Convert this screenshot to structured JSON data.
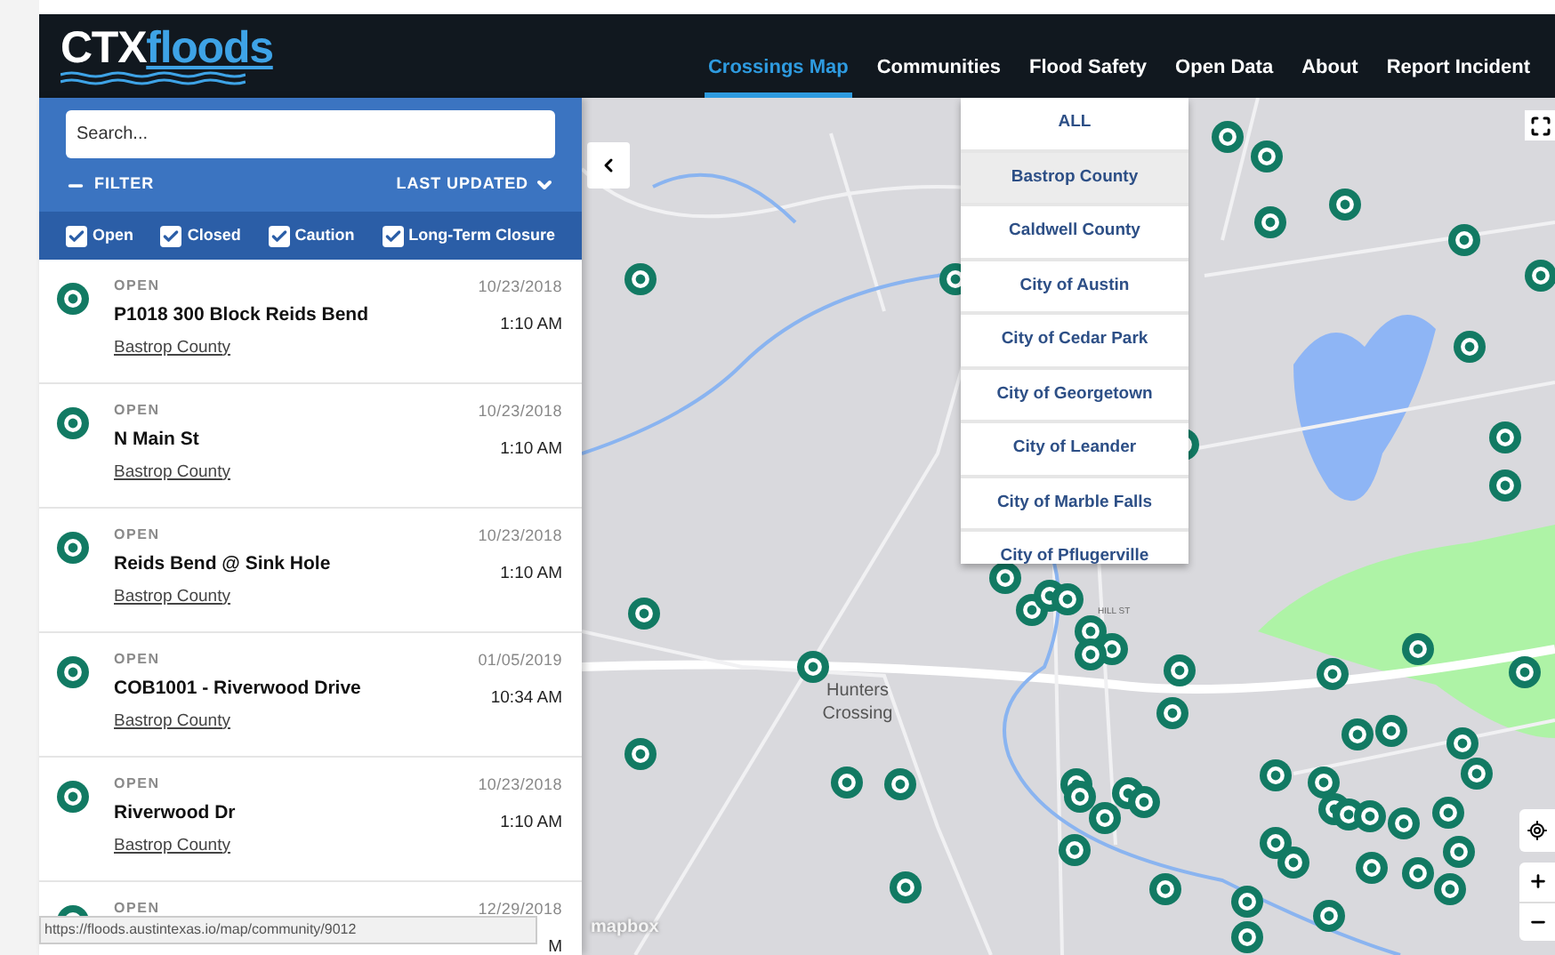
{
  "logo": {
    "prefix": "CTX",
    "suffix": "floods"
  },
  "nav": [
    {
      "label": "Crossings Map",
      "selected": true
    },
    {
      "label": "Communities",
      "selected": false
    },
    {
      "label": "Flood Safety",
      "selected": false
    },
    {
      "label": "Open Data",
      "selected": false
    },
    {
      "label": "About",
      "selected": false
    },
    {
      "label": "Report Incident",
      "selected": false
    }
  ],
  "communities_menu": [
    {
      "label": "ALL",
      "selected": false
    },
    {
      "label": "Bastrop County",
      "selected": true
    },
    {
      "label": "Caldwell County",
      "selected": false
    },
    {
      "label": "City of Austin",
      "selected": false
    },
    {
      "label": "City of Cedar Park",
      "selected": false
    },
    {
      "label": "City of Georgetown",
      "selected": false
    },
    {
      "label": "City of Leander",
      "selected": false
    },
    {
      "label": "City of Marble Falls",
      "selected": false
    },
    {
      "label": "City of Pflugerville",
      "selected": false
    }
  ],
  "search": {
    "placeholder": "Search..."
  },
  "filter": {
    "toggle": "FILTER",
    "sort": "LAST UPDATED",
    "expanded": true
  },
  "status_filters": [
    {
      "label": "Open",
      "checked": true
    },
    {
      "label": "Closed",
      "checked": true
    },
    {
      "label": "Caution",
      "checked": true
    },
    {
      "label": "Long-Term Closure",
      "checked": true
    }
  ],
  "crossings": [
    {
      "status": "OPEN",
      "name": "P1018 300 Block Reids Bend",
      "community": "Bastrop County",
      "date": "10/23/2018",
      "time": "1:10 AM"
    },
    {
      "status": "OPEN",
      "name": "N Main St",
      "community": "Bastrop County",
      "date": "10/23/2018",
      "time": "1:10 AM"
    },
    {
      "status": "OPEN",
      "name": "Reids Bend @ Sink Hole",
      "community": "Bastrop County",
      "date": "10/23/2018",
      "time": "1:10 AM"
    },
    {
      "status": "OPEN",
      "name": "COB1001 - Riverwood Drive",
      "community": "Bastrop County",
      "date": "01/05/2019",
      "time": "10:34 AM"
    },
    {
      "status": "OPEN",
      "name": "Riverwood Dr",
      "community": "Bastrop County",
      "date": "10/23/2018",
      "time": "1:10 AM"
    },
    {
      "status": "OPEN",
      "date": "12/29/2018",
      "time": "M"
    }
  ],
  "status_url": "https://floods.austintexas.io/map/community/9012",
  "map": {
    "place_label": "Hunters Crossing",
    "street_label": "HILL ST",
    "attribution": "mapbox"
  }
}
